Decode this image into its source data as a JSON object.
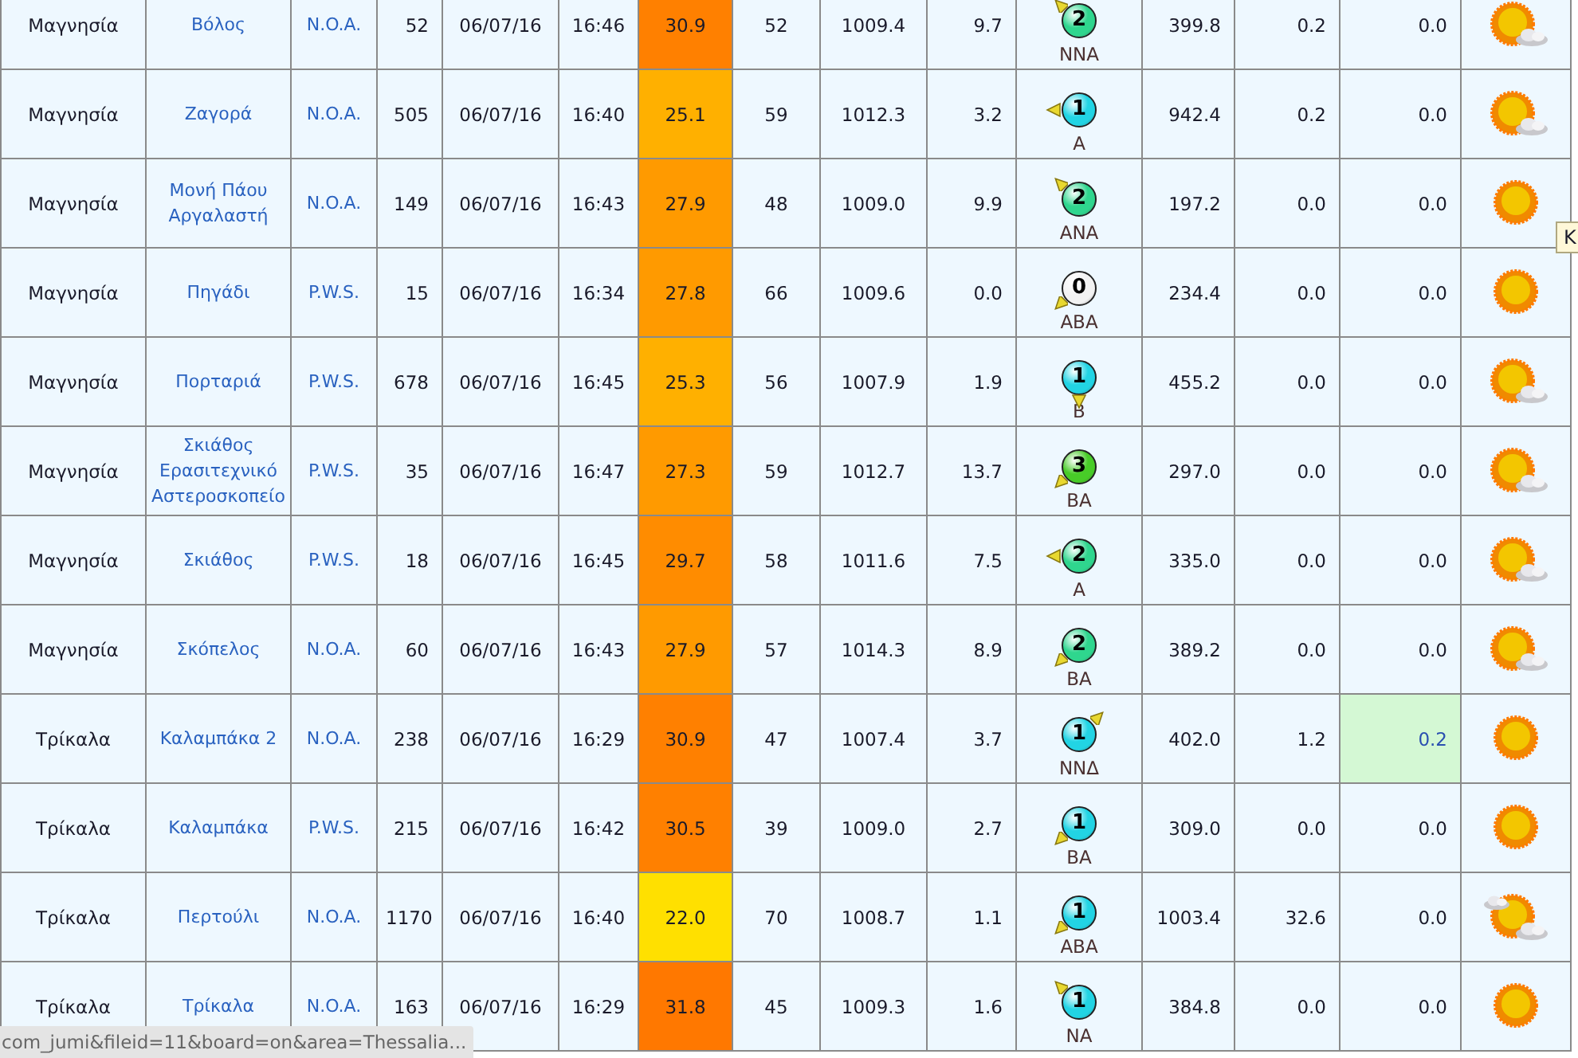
{
  "table": {
    "rows": [
      {
        "column_1": "Μαγνησία",
        "column_2": "Βόλος",
        "column_3": "N.O.A.",
        "column_4": "52",
        "column_5": "06/07/16",
        "column_6": "16:46",
        "column_7": {
          "value": "30.9",
          "color": "#ff8000"
        },
        "column_8": "52",
        "column_9": "1009.4",
        "column_10": "9.7",
        "column_11": {
          "force": "2",
          "direction": "NNA",
          "kind": "nw",
          "color": "#2fd68e"
        },
        "column_12": "399.8",
        "column_13": "0.2",
        "column_14": {
          "value": "0.0",
          "highlighted": false
        },
        "column_15": {
          "kind": "sun-cloud"
        }
      },
      {
        "column_1": "Μαγνησία",
        "column_2": "Ζαγορά",
        "column_3": "N.O.A.",
        "column_4": "505",
        "column_5": "06/07/16",
        "column_6": "16:40",
        "column_7": {
          "value": "25.1",
          "color": "#ffb000"
        },
        "column_8": "59",
        "column_9": "1012.3",
        "column_10": "3.2",
        "column_11": {
          "force": "1",
          "direction": "A",
          "kind": "w",
          "color": "#22d4e4"
        },
        "column_12": "942.4",
        "column_13": "0.2",
        "column_14": {
          "value": "0.0",
          "highlighted": false
        },
        "column_15": {
          "kind": "sun-cloud"
        }
      },
      {
        "column_1": "Μαγνησία",
        "column_2": "Μονή Πάου Αργαλαστή",
        "column_3": "N.O.A.",
        "column_4": "149",
        "column_5": "06/07/16",
        "column_6": "16:43",
        "column_7": {
          "value": "27.9",
          "color": "#ff9a00"
        },
        "column_8": "48",
        "column_9": "1009.0",
        "column_10": "9.9",
        "column_11": {
          "force": "2",
          "direction": "ANA",
          "kind": "nw",
          "color": "#2fd68e"
        },
        "column_12": "197.2",
        "column_13": "0.0",
        "column_14": {
          "value": "0.0",
          "highlighted": false
        },
        "column_15": {
          "kind": "sun"
        }
      },
      {
        "column_1": "Μαγνησία",
        "column_2": "Πηγάδι",
        "column_3": "P.W.S.",
        "column_4": "15",
        "column_5": "06/07/16",
        "column_6": "16:34",
        "column_7": {
          "value": "27.8",
          "color": "#ff9a00"
        },
        "column_8": "66",
        "column_9": "1009.6",
        "column_10": "0.0",
        "column_11": {
          "force": "0",
          "direction": "ABA",
          "kind": "sw",
          "color": "#f2f2f2"
        },
        "column_12": "234.4",
        "column_13": "0.0",
        "column_14": {
          "value": "0.0",
          "highlighted": false
        },
        "column_15": {
          "kind": "sun"
        }
      },
      {
        "column_1": "Μαγνησία",
        "column_2": "Πορταριά",
        "column_3": "P.W.S.",
        "column_4": "678",
        "column_5": "06/07/16",
        "column_6": "16:45",
        "column_7": {
          "value": "25.3",
          "color": "#ffb000"
        },
        "column_8": "56",
        "column_9": "1007.9",
        "column_10": "1.9",
        "column_11": {
          "force": "1",
          "direction": "B",
          "kind": "s",
          "color": "#22d4e4"
        },
        "column_12": "455.2",
        "column_13": "0.0",
        "column_14": {
          "value": "0.0",
          "highlighted": false
        },
        "column_15": {
          "kind": "sun-cloud"
        }
      },
      {
        "column_1": "Μαγνησία",
        "column_2": "Σκιάθος Ερασιτεχνικό Αστεροσκοπείο",
        "column_3": "P.W.S.",
        "column_4": "35",
        "column_5": "06/07/16",
        "column_6": "16:47",
        "column_7": {
          "value": "27.3",
          "color": "#ff9a00"
        },
        "column_8": "59",
        "column_9": "1012.7",
        "column_10": "13.7",
        "column_11": {
          "force": "3",
          "direction": "BA",
          "kind": "sw",
          "color": "#48cc28"
        },
        "column_12": "297.0",
        "column_13": "0.0",
        "column_14": {
          "value": "0.0",
          "highlighted": false
        },
        "column_15": {
          "kind": "sun-cloud"
        }
      },
      {
        "column_1": "Μαγνησία",
        "column_2": "Σκιάθος",
        "column_3": "P.W.S.",
        "column_4": "18",
        "column_5": "06/07/16",
        "column_6": "16:45",
        "column_7": {
          "value": "29.7",
          "color": "#ff8c00"
        },
        "column_8": "58",
        "column_9": "1011.6",
        "column_10": "7.5",
        "column_11": {
          "force": "2",
          "direction": "A",
          "kind": "w",
          "color": "#2fd68e"
        },
        "column_12": "335.0",
        "column_13": "0.0",
        "column_14": {
          "value": "0.0",
          "highlighted": false
        },
        "column_15": {
          "kind": "sun-cloud"
        }
      },
      {
        "column_1": "Μαγνησία",
        "column_2": "Σκόπελος",
        "column_3": "N.O.A.",
        "column_4": "60",
        "column_5": "06/07/16",
        "column_6": "16:43",
        "column_7": {
          "value": "27.9",
          "color": "#ff9a00"
        },
        "column_8": "57",
        "column_9": "1014.3",
        "column_10": "8.9",
        "column_11": {
          "force": "2",
          "direction": "BA",
          "kind": "sw",
          "color": "#2fd68e"
        },
        "column_12": "389.2",
        "column_13": "0.0",
        "column_14": {
          "value": "0.0",
          "highlighted": false
        },
        "column_15": {
          "kind": "sun-cloud"
        }
      },
      {
        "column_1": "Τρίκαλα",
        "column_2": "Καλαμπάκα 2",
        "column_3": "N.O.A.",
        "column_4": "238",
        "column_5": "06/07/16",
        "column_6": "16:29",
        "column_7": {
          "value": "30.9",
          "color": "#ff8000"
        },
        "column_8": "47",
        "column_9": "1007.4",
        "column_10": "3.7",
        "column_11": {
          "force": "1",
          "direction": "NNΔ",
          "kind": "ne",
          "color": "#22d4e4"
        },
        "column_12": "402.0",
        "column_13": "1.2",
        "column_14": {
          "value": "0.2",
          "highlighted": true
        },
        "column_15": {
          "kind": "sun"
        }
      },
      {
        "column_1": "Τρίκαλα",
        "column_2": "Καλαμπάκα",
        "column_3": "P.W.S.",
        "column_4": "215",
        "column_5": "06/07/16",
        "column_6": "16:42",
        "column_7": {
          "value": "30.5",
          "color": "#ff8000"
        },
        "column_8": "39",
        "column_9": "1009.0",
        "column_10": "2.7",
        "column_11": {
          "force": "1",
          "direction": "BA",
          "kind": "sw",
          "color": "#22d4e4"
        },
        "column_12": "309.0",
        "column_13": "0.0",
        "column_14": {
          "value": "0.0",
          "highlighted": false
        },
        "column_15": {
          "kind": "sun"
        }
      },
      {
        "column_1": "Τρίκαλα",
        "column_2": "Περτούλι",
        "column_3": "N.O.A.",
        "column_4": "1170",
        "column_5": "06/07/16",
        "column_6": "16:40",
        "column_7": {
          "value": "22.0",
          "color": "#ffe000"
        },
        "column_8": "70",
        "column_9": "1008.7",
        "column_10": "1.1",
        "column_11": {
          "force": "1",
          "direction": "ABA",
          "kind": "sw",
          "color": "#22d4e4"
        },
        "column_12": "1003.4",
        "column_13": "32.6",
        "column_14": {
          "value": "0.0",
          "highlighted": false
        },
        "column_15": {
          "kind": "sun-clouds"
        }
      },
      {
        "column_1": "Τρίκαλα",
        "column_2": "Τρίκαλα",
        "column_3": "N.O.A.",
        "column_4": "163",
        "column_5": "06/07/16",
        "column_6": "16:29",
        "column_7": {
          "value": "31.8",
          "color": "#ff7800"
        },
        "column_8": "45",
        "column_9": "1009.3",
        "column_10": "1.6",
        "column_11": {
          "force": "1",
          "direction": "NA",
          "kind": "nw",
          "color": "#22d4e4"
        },
        "column_12": "384.8",
        "column_13": "0.0",
        "column_14": {
          "value": "0.0",
          "highlighted": false
        },
        "column_15": {
          "kind": "sun"
        }
      }
    ]
  },
  "tooltip": {
    "text": "K"
  },
  "status_bar": {
    "text": "com_jumi&fileid=11&board=on&area=Thessalia..."
  }
}
